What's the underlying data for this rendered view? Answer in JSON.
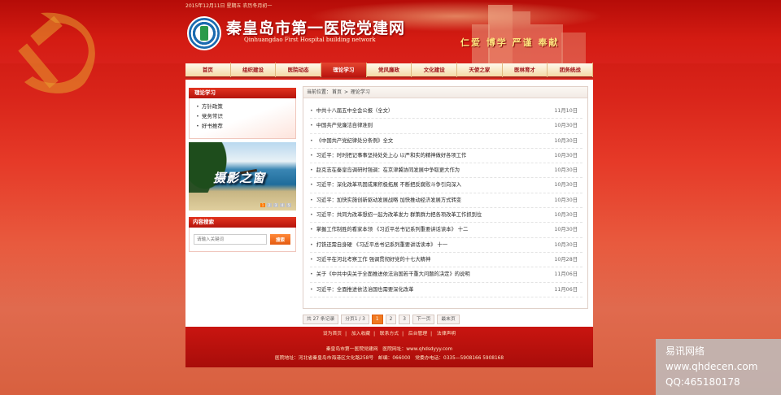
{
  "header": {
    "date": "2015年12月11日 星期五 农历冬月初一",
    "title": "秦皇岛市第一医院党建网",
    "subtitle": "Qinhuangdao First Hospital building network",
    "motto": "仁爱 博学 严谨 奉献"
  },
  "nav": [
    {
      "label": "首页"
    },
    {
      "label": "组织建设"
    },
    {
      "label": "医院动态"
    },
    {
      "label": "理论学习"
    },
    {
      "label": "党风廉政"
    },
    {
      "label": "文化建设"
    },
    {
      "label": "天使之家"
    },
    {
      "label": "医林育才"
    },
    {
      "label": "团务统战"
    }
  ],
  "sidebar": {
    "section_title": "理论学习",
    "links": [
      "方针政策",
      "党务常识",
      "好书推荐"
    ],
    "banner_title": "摄影之窗",
    "banner_dots": [
      "1",
      "2",
      "3",
      "4",
      "5"
    ],
    "search_title": "内容搜索",
    "search_placeholder": "请输入关键词",
    "search_button": "搜索"
  },
  "breadcrumb": {
    "prefix": "当前位置：",
    "home": "首页",
    "sep": " > ",
    "current": "理论学习"
  },
  "articles": [
    {
      "title": "中共十八届五中全会公报（全文）",
      "date": "11月10日"
    },
    {
      "title": "中国共产党廉洁自律准则",
      "date": "10月30日"
    },
    {
      "title": "《中国共产党纪律处分条例》全文",
      "date": "10月30日"
    },
    {
      "title": "习近平：时时把记事事坚持处处上心 以严和实的精神做好各项工作",
      "date": "10月30日"
    },
    {
      "title": "赵克志在秦皇岛调研时强调：在京津冀协同发展中争取更大作为",
      "date": "10月30日"
    },
    {
      "title": "习近平：深化改革巩固成果积极拓展 不断把反腐败斗争引向深入",
      "date": "10月30日"
    },
    {
      "title": "习近平：加快实施创新驱动发展战略 加快推动经济发展方式转变",
      "date": "10月30日"
    },
    {
      "title": "习近平：共同为改革想招一起为改革发力 群策群力把各项改革工作抓到位",
      "date": "10月30日"
    },
    {
      "title": "掌握工作制胜的看家本领 《习近平总书记系列重要讲话读本》 十二",
      "date": "10月30日"
    },
    {
      "title": "打铁还需自身硬 《习近平总书记系列重要讲话读本》 十一",
      "date": "10月30日"
    },
    {
      "title": "习近平在河北考察工作 强调贯彻好党的十七大精神",
      "date": "10月28日"
    },
    {
      "title": "关于《中共中央关于全面推进依法治国若干重大问题的决定》的说明",
      "date": "11月06日"
    },
    {
      "title": "习近平：全面推进依法治国也需要深化改革",
      "date": "11月06日"
    }
  ],
  "pager": {
    "total": "共 27 条记录",
    "page_info": "分页1 / 3",
    "pages": [
      "1",
      "2",
      "3"
    ],
    "next": "下一页",
    "last": "最末页"
  },
  "footer": {
    "links": [
      "设为首页",
      "加入收藏",
      "联系方式",
      "后台管理",
      "法律声明"
    ],
    "line1": "秦皇岛市第一医院党建网　医院网址：www.qhdsdyyy.com",
    "line2": "医院地址：河北省秦皇岛市海港区文化路258号　邮编：066000　党委办电话：0335—5908166 5908168"
  },
  "watermark": {
    "line1": "易讯网络",
    "line2": "www.qhdecen.com",
    "line3": "QQ:465180178"
  },
  "colors": {
    "brand_red": "#c91510",
    "accent_orange": "#f07a22",
    "motto_yellow": "#ffe680"
  }
}
